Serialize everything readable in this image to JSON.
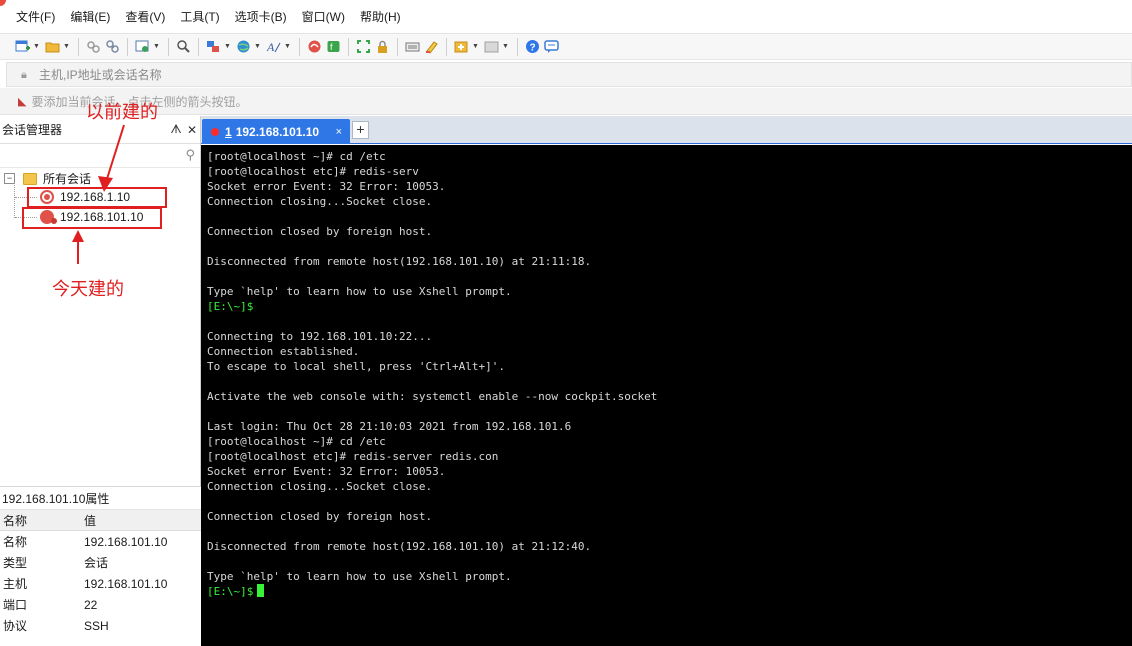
{
  "menu": {
    "items": [
      "文件(F)",
      "编辑(E)",
      "查看(V)",
      "工具(T)",
      "选项卡(B)",
      "窗口(W)",
      "帮助(H)"
    ]
  },
  "toolbar": {
    "icons": [
      "new-session-icon",
      "open-folder-icon",
      "link-icon",
      "unlink-icon",
      "properties-icon",
      "search-icon",
      "transfer-icon",
      "globe-icon",
      "font-icon",
      "xshell-icon",
      "xftp-icon",
      "fullscreen-icon",
      "lock-icon",
      "keyboard-icon",
      "highlight-icon",
      "add-icon",
      "layout-icon",
      "help-icon",
      "chat-icon"
    ]
  },
  "address": {
    "placeholder": "主机,IP地址或会话名称"
  },
  "hint": {
    "text": "要添加当前会话，点击左侧的箭头按钮。"
  },
  "sidebar": {
    "title": "会话管理器",
    "pin": "ᗑ",
    "close": "✕",
    "root": "所有会话",
    "sessions": [
      {
        "label": "192.168.1.10"
      },
      {
        "label": "192.168.101.10"
      }
    ]
  },
  "annotations": {
    "old": "以前建的",
    "new": "今天建的",
    "color": "#e02020"
  },
  "properties": {
    "title": "192.168.101.10属性",
    "headers": [
      "名称",
      "值"
    ],
    "rows": [
      [
        "名称",
        "192.168.101.10"
      ],
      [
        "类型",
        "会话"
      ],
      [
        "主机",
        "192.168.101.10"
      ],
      [
        "端口",
        "22"
      ],
      [
        "协议",
        "SSH"
      ]
    ]
  },
  "tab": {
    "number": "1",
    "label": "192.168.101.10",
    "close": "×",
    "new": "+"
  },
  "terminal": {
    "lines": [
      {
        "text": "[root@localhost ~]# cd /etc",
        "prompt": false
      },
      {
        "text": "[root@localhost etc]# redis-serv",
        "prompt": false
      },
      {
        "text": "Socket error Event: 32 Error: 10053.",
        "prompt": false
      },
      {
        "text": "Connection closing...Socket close.",
        "prompt": false
      },
      {
        "text": "",
        "prompt": false
      },
      {
        "text": "Connection closed by foreign host.",
        "prompt": false
      },
      {
        "text": "",
        "prompt": false
      },
      {
        "text": "Disconnected from remote host(192.168.101.10) at 21:11:18.",
        "prompt": false
      },
      {
        "text": "",
        "prompt": false
      },
      {
        "text": "Type `help' to learn how to use Xshell prompt.",
        "prompt": false
      },
      {
        "text": "[E:\\~]$",
        "prompt": true
      },
      {
        "text": "",
        "prompt": false
      },
      {
        "text": "Connecting to 192.168.101.10:22...",
        "prompt": false
      },
      {
        "text": "Connection established.",
        "prompt": false
      },
      {
        "text": "To escape to local shell, press 'Ctrl+Alt+]'.",
        "prompt": false
      },
      {
        "text": "",
        "prompt": false
      },
      {
        "text": "Activate the web console with: systemctl enable --now cockpit.socket",
        "prompt": false
      },
      {
        "text": "",
        "prompt": false
      },
      {
        "text": "Last login: Thu Oct 28 21:10:03 2021 from 192.168.101.6",
        "prompt": false
      },
      {
        "text": "[root@localhost ~]# cd /etc",
        "prompt": false
      },
      {
        "text": "[root@localhost etc]# redis-server redis.con",
        "prompt": false
      },
      {
        "text": "Socket error Event: 32 Error: 10053.",
        "prompt": false
      },
      {
        "text": "Connection closing...Socket close.",
        "prompt": false
      },
      {
        "text": "",
        "prompt": false
      },
      {
        "text": "Connection closed by foreign host.",
        "prompt": false
      },
      {
        "text": "",
        "prompt": false
      },
      {
        "text": "Disconnected from remote host(192.168.101.10) at 21:12:40.",
        "prompt": false
      },
      {
        "text": "",
        "prompt": false
      },
      {
        "text": "Type `help' to learn how to use Xshell prompt.",
        "prompt": false
      },
      {
        "text": "[E:\\~]$",
        "prompt": true
      }
    ],
    "prompt_color": "#38f238"
  }
}
